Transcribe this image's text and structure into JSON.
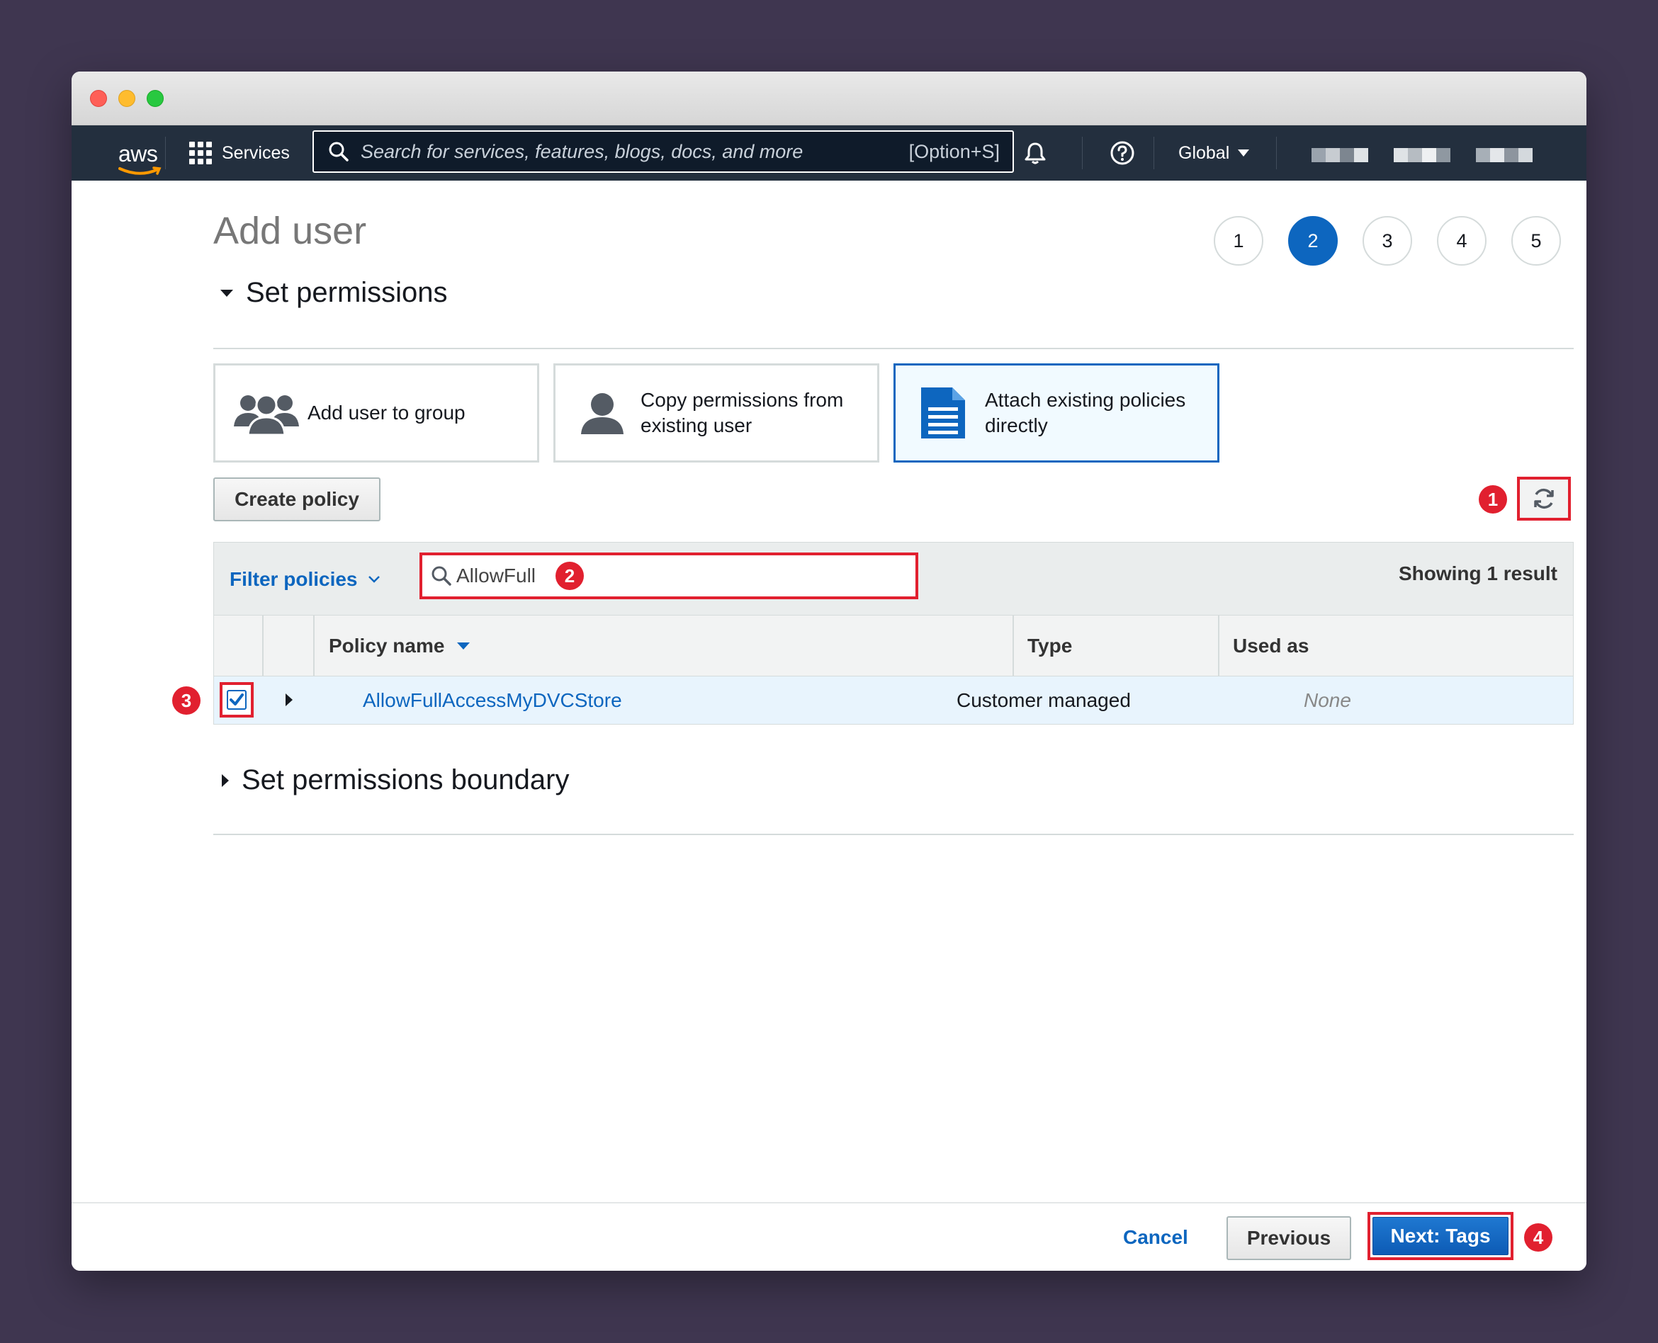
{
  "navbar": {
    "logo": "aws",
    "services_label": "Services",
    "search_placeholder": "Search for services, features, blogs, docs, and more",
    "search_shortcut": "[Option+S]",
    "region_label": "Global"
  },
  "page": {
    "title": "Add user",
    "steps": [
      "1",
      "2",
      "3",
      "4",
      "5"
    ],
    "active_step": "2"
  },
  "permissions": {
    "section_title": "Set permissions",
    "options": [
      {
        "label_line1": "Add user to group",
        "label_line2": "",
        "selected": false
      },
      {
        "label_line1": "Copy permissions from",
        "label_line2": "existing user",
        "selected": false
      },
      {
        "label_line1": "Attach existing policies",
        "label_line2": "directly",
        "selected": true
      }
    ],
    "create_policy_label": "Create policy",
    "filter_label": "Filter policies",
    "filter_value": "AllowFull",
    "result_count": "Showing 1 result",
    "columns": {
      "policy_name": "Policy name",
      "type": "Type",
      "used_as": "Used as"
    },
    "rows": [
      {
        "name": "AllowFullAccessMyDVCStore",
        "type": "Customer managed",
        "used_as": "None",
        "checked": true
      }
    ]
  },
  "boundary": {
    "section_title": "Set permissions boundary"
  },
  "annotations": [
    "1",
    "2",
    "3",
    "4"
  ],
  "footer": {
    "cancel_label": "Cancel",
    "previous_label": "Previous",
    "next_label": "Next: Tags"
  },
  "colors": {
    "accent_blue": "#0d66bf",
    "annotation_red": "#e1202f",
    "navbar_bg": "#232f3e",
    "selected_row_bg": "#e8f4fd"
  }
}
